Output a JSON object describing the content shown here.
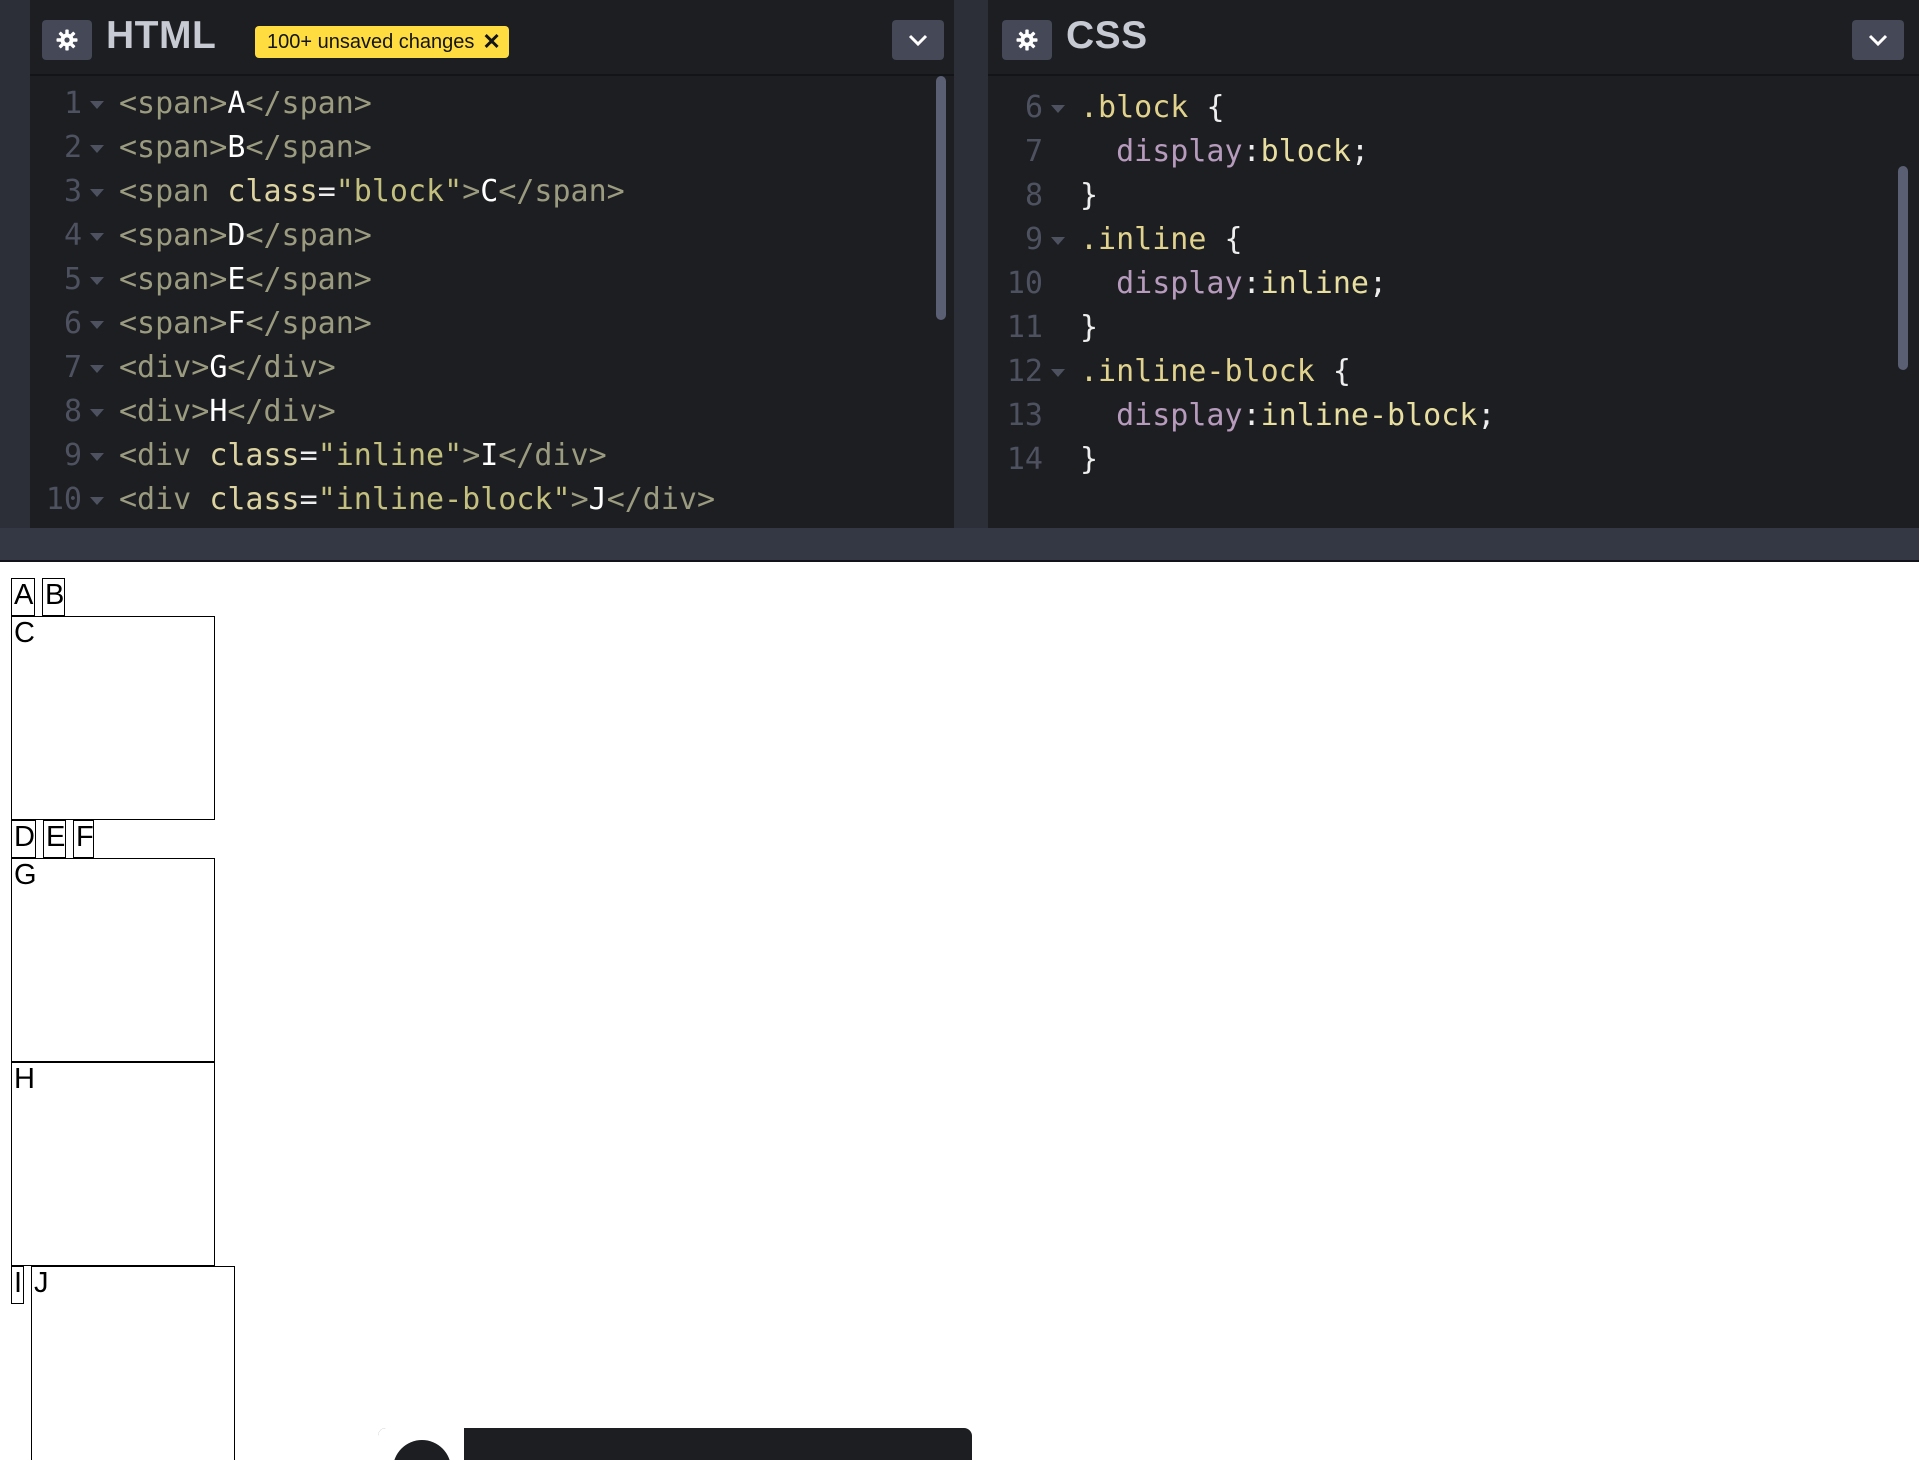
{
  "html_panel": {
    "title": "HTML",
    "badge": "100+ unsaved changes",
    "badge_close": "✕",
    "lines": [
      {
        "n": "1",
        "parts": [
          [
            "tag",
            "<span>"
          ],
          [
            "txt",
            "A"
          ],
          [
            "tag",
            "</span>"
          ]
        ]
      },
      {
        "n": "2",
        "parts": [
          [
            "tag",
            "<span>"
          ],
          [
            "txt",
            "B"
          ],
          [
            "tag",
            "</span>"
          ]
        ]
      },
      {
        "n": "3",
        "parts": [
          [
            "tag",
            "<span "
          ],
          [
            "attr",
            "class"
          ],
          [
            "punct",
            "="
          ],
          [
            "str",
            "\"block\""
          ],
          [
            "tag",
            ">"
          ],
          [
            "txt",
            "C"
          ],
          [
            "tag",
            "</span>"
          ]
        ]
      },
      {
        "n": "4",
        "parts": [
          [
            "tag",
            "<span>"
          ],
          [
            "txt",
            "D"
          ],
          [
            "tag",
            "</span>"
          ]
        ]
      },
      {
        "n": "5",
        "parts": [
          [
            "tag",
            "<span>"
          ],
          [
            "txt",
            "E"
          ],
          [
            "tag",
            "</span>"
          ]
        ]
      },
      {
        "n": "6",
        "parts": [
          [
            "tag",
            "<span>"
          ],
          [
            "txt",
            "F"
          ],
          [
            "tag",
            "</span>"
          ]
        ]
      },
      {
        "n": "7",
        "parts": [
          [
            "tag",
            "<div>"
          ],
          [
            "txt",
            "G"
          ],
          [
            "tag",
            "</div>"
          ]
        ]
      },
      {
        "n": "8",
        "parts": [
          [
            "tag",
            "<div>"
          ],
          [
            "txt",
            "H"
          ],
          [
            "tag",
            "</div>"
          ]
        ]
      },
      {
        "n": "9",
        "parts": [
          [
            "tag",
            "<div "
          ],
          [
            "attr",
            "class"
          ],
          [
            "punct",
            "="
          ],
          [
            "str",
            "\"inline\""
          ],
          [
            "tag",
            ">"
          ],
          [
            "txt",
            "I"
          ],
          [
            "tag",
            "</div>"
          ]
        ]
      },
      {
        "n": "10",
        "parts": [
          [
            "tag",
            "<div "
          ],
          [
            "attr",
            "class"
          ],
          [
            "punct",
            "="
          ],
          [
            "str",
            "\"inline-block\""
          ],
          [
            "tag",
            ">"
          ],
          [
            "txt",
            "J"
          ],
          [
            "tag",
            "</div>"
          ]
        ]
      }
    ]
  },
  "css_panel": {
    "title": "CSS",
    "lines": [
      {
        "n": "6",
        "fold": true,
        "parts": [
          [
            "sel",
            ".block "
          ],
          [
            "punct",
            "{"
          ]
        ]
      },
      {
        "n": "7",
        "fold": false,
        "parts": [
          [
            "ind",
            "  "
          ],
          [
            "prop",
            "display"
          ],
          [
            "punct",
            ":"
          ],
          [
            "val",
            "block"
          ],
          [
            "punct",
            ";"
          ]
        ]
      },
      {
        "n": "8",
        "fold": false,
        "parts": [
          [
            "punct",
            "}"
          ]
        ]
      },
      {
        "n": "9",
        "fold": true,
        "parts": [
          [
            "sel",
            ".inline "
          ],
          [
            "punct",
            "{"
          ]
        ]
      },
      {
        "n": "10",
        "fold": false,
        "parts": [
          [
            "ind",
            "  "
          ],
          [
            "prop",
            "display"
          ],
          [
            "punct",
            ":"
          ],
          [
            "val",
            "inline"
          ],
          [
            "punct",
            ";"
          ]
        ]
      },
      {
        "n": "11",
        "fold": false,
        "parts": [
          [
            "punct",
            "}"
          ]
        ]
      },
      {
        "n": "12",
        "fold": true,
        "parts": [
          [
            "sel",
            ".inline-block "
          ],
          [
            "punct",
            "{"
          ]
        ]
      },
      {
        "n": "13",
        "fold": false,
        "parts": [
          [
            "ind",
            "  "
          ],
          [
            "prop",
            "display"
          ],
          [
            "punct",
            ":"
          ],
          [
            "val",
            "inline-block"
          ],
          [
            "punct",
            ";"
          ]
        ]
      },
      {
        "n": "14",
        "fold": false,
        "parts": [
          [
            "punct",
            "}"
          ]
        ]
      }
    ]
  },
  "preview": {
    "A": "A",
    "B": "B",
    "C": "C",
    "D": "D",
    "E": "E",
    "F": "F",
    "G": "G",
    "H": "H",
    "I": "I",
    "J": "J"
  },
  "icons": {
    "settings": "gear-icon",
    "collapse": "chevron-down-icon",
    "close_badge": "close-icon"
  },
  "colors": {
    "editor_bg": "#1d1e22",
    "badge_bg": "#ffdd40",
    "button_bg": "#444857"
  }
}
